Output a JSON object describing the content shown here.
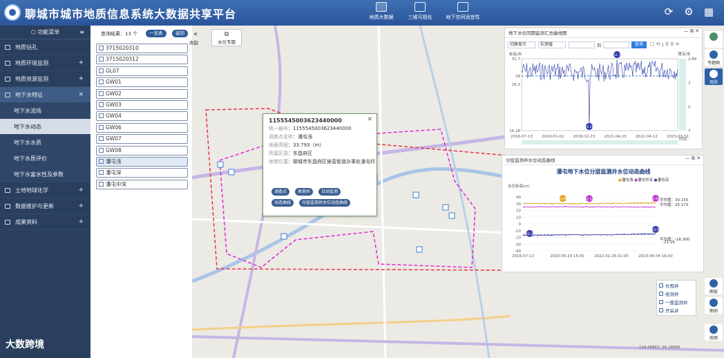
{
  "app": {
    "title": "聊城市城市地质信息系统大数据共享平台",
    "top_nav": [
      {
        "label": "地质大数据",
        "active": true
      },
      {
        "label": "三维可视化",
        "active": false
      },
      {
        "label": "地下空间适宜性",
        "active": false
      }
    ],
    "top_right_icons": [
      "refresh-icon",
      "settings-icon",
      "grid-icon"
    ]
  },
  "sidebar": {
    "header": "功能菜单",
    "items": [
      {
        "label": "地质钻孔",
        "icon": "drill-icon",
        "expand": ""
      },
      {
        "label": "地质环境监测",
        "icon": "monitor-icon",
        "expand": "+"
      },
      {
        "label": "地质资源监测",
        "icon": "resource-icon",
        "expand": "+"
      },
      {
        "label": "地下水特征",
        "icon": "water-icon",
        "expand": "×",
        "open": true,
        "children": [
          "地下水流场",
          "地下水动态",
          "地下水水质",
          "地下水质评价",
          "地下水富水性及参数"
        ],
        "selected": "地下水动态"
      },
      {
        "label": "土地地球化学",
        "icon": "geochem-icon",
        "expand": "+"
      },
      {
        "label": "数据维护与更新",
        "icon": "data-icon",
        "expand": "+"
      },
      {
        "label": "成果资料",
        "icon": "chart-icon",
        "expand": "+"
      }
    ]
  },
  "list": {
    "result_text": "查询结果：13 个",
    "btn_all": "一览表",
    "btn_back": "返回",
    "wells": [
      "3715020310",
      "3715020312",
      "GL07",
      "GW01",
      "GW02",
      "GW03",
      "GW04",
      "GW06",
      "GW07",
      "GW08",
      "潘屯浅",
      "潘屯深",
      "潘屯中深"
    ],
    "selected_index": 10,
    "collapse_glyph": "«",
    "collapse_label": "收起"
  },
  "map": {
    "water_topic_btn": "水位专题",
    "popup": {
      "title": "1155545003623440000",
      "rows": [
        {
          "k": "统一编号",
          "v": "1155545003623440000"
        },
        {
          "k": "调查点名称",
          "v": "潘屯浅"
        },
        {
          "k": "地面高程",
          "v": "33.793（m）"
        },
        {
          "k": "所属区县",
          "v": "东昌府区"
        },
        {
          "k": "地理位置",
          "v": "聊城市东昌府区侯营街道办事处潘屯村"
        }
      ],
      "buttons": [
        "调查点",
        "高测井",
        "日动监测",
        "动态曲线",
        "分层监测井水位动态曲线"
      ]
    },
    "legend": [
      {
        "label": "长观井",
        "color": "#2f62a8"
      },
      {
        "label": "统测井",
        "color": "#3a8fd6"
      },
      {
        "label": "一般监测井",
        "color": "#5fb0e8"
      },
      {
        "label": "开采井",
        "color": "#8fb6e0"
      }
    ],
    "coord": "116.06867, 36.28686"
  },
  "panel1": {
    "title": "地下水位同期监测汇总曲线图",
    "select1": "切换显示",
    "select2": "实测值",
    "date_sep": "到",
    "query_btn": "查询",
    "y_left_label": "标高/米",
    "y_right_label": "埋深/米",
    "x_label": "时间"
  },
  "panel2": {
    "title": "分层监测井水位动态曲线",
    "chart_title": "潘屯地下水位分层监测井水位动态曲线",
    "unit": "水位标高(m)",
    "legend": [
      "潘屯浅",
      "潘屯中深",
      "潘屯深"
    ],
    "avg_label1": "平均值：30.155",
    "avg_label2": "平均值：25.173",
    "avg_label3": "平均值：-16.300",
    "avg_label4": "-21.16",
    "marker_labels": [
      "31.66",
      "31.52",
      "31.92",
      "-14.26",
      "-20.32"
    ]
  },
  "right_tools": [
    {
      "label": "专题图",
      "icon": "topic-icon"
    },
    {
      "label": "风险",
      "icon": "risk-icon"
    },
    {
      "label": "图层",
      "icon": "layer-icon"
    },
    {
      "label": "图例",
      "icon": "legend-icon"
    },
    {
      "label": "底图",
      "icon": "basemap-icon"
    }
  ],
  "chart_data": [
    {
      "type": "line",
      "title": "",
      "x": [
        "2016-07-13",
        "2019-01-02",
        "2019-12-23",
        "2021-04-23",
        "2022-04-12",
        "2023-03-31"
      ],
      "series": [
        {
          "name": "",
          "values": [
            31.0,
            31.1,
            30.6,
            30.9,
            31.4,
            31.2
          ]
        }
      ],
      "ylim_left": [
        16.28,
        31.7
      ],
      "ylim_right": [
        7,
        2.89
      ],
      "y_ticks_left": [
        31.7,
        28,
        26.2,
        16.28
      ],
      "y_ticks_right": [
        2.89,
        3,
        5,
        7
      ],
      "markers": [
        "31.7",
        "16.28"
      ]
    },
    {
      "type": "line",
      "title": "潘屯地下水位分层监测井水位动态曲线",
      "x": [
        "2016-07-13",
        "2020-05-29 15:00",
        "2022-01-26 01:00",
        "2023-06-04 16:00"
      ],
      "series": [
        {
          "name": "潘屯浅",
          "values": [
            30.2,
            30.0,
            30.3,
            31.5
          ]
        },
        {
          "name": "潘屯中深",
          "values": [
            25.2,
            25.5,
            25.2,
            25.1
          ]
        },
        {
          "name": "潘屯深",
          "values": [
            -17.2,
            -16.4,
            -16.0,
            -14.26
          ]
        }
      ],
      "ylim": [
        -40,
        40
      ],
      "y_ticks": [
        40,
        30,
        20,
        10,
        0,
        -10,
        -20,
        -30,
        -40
      ]
    }
  ],
  "watermark": "大数跨境"
}
